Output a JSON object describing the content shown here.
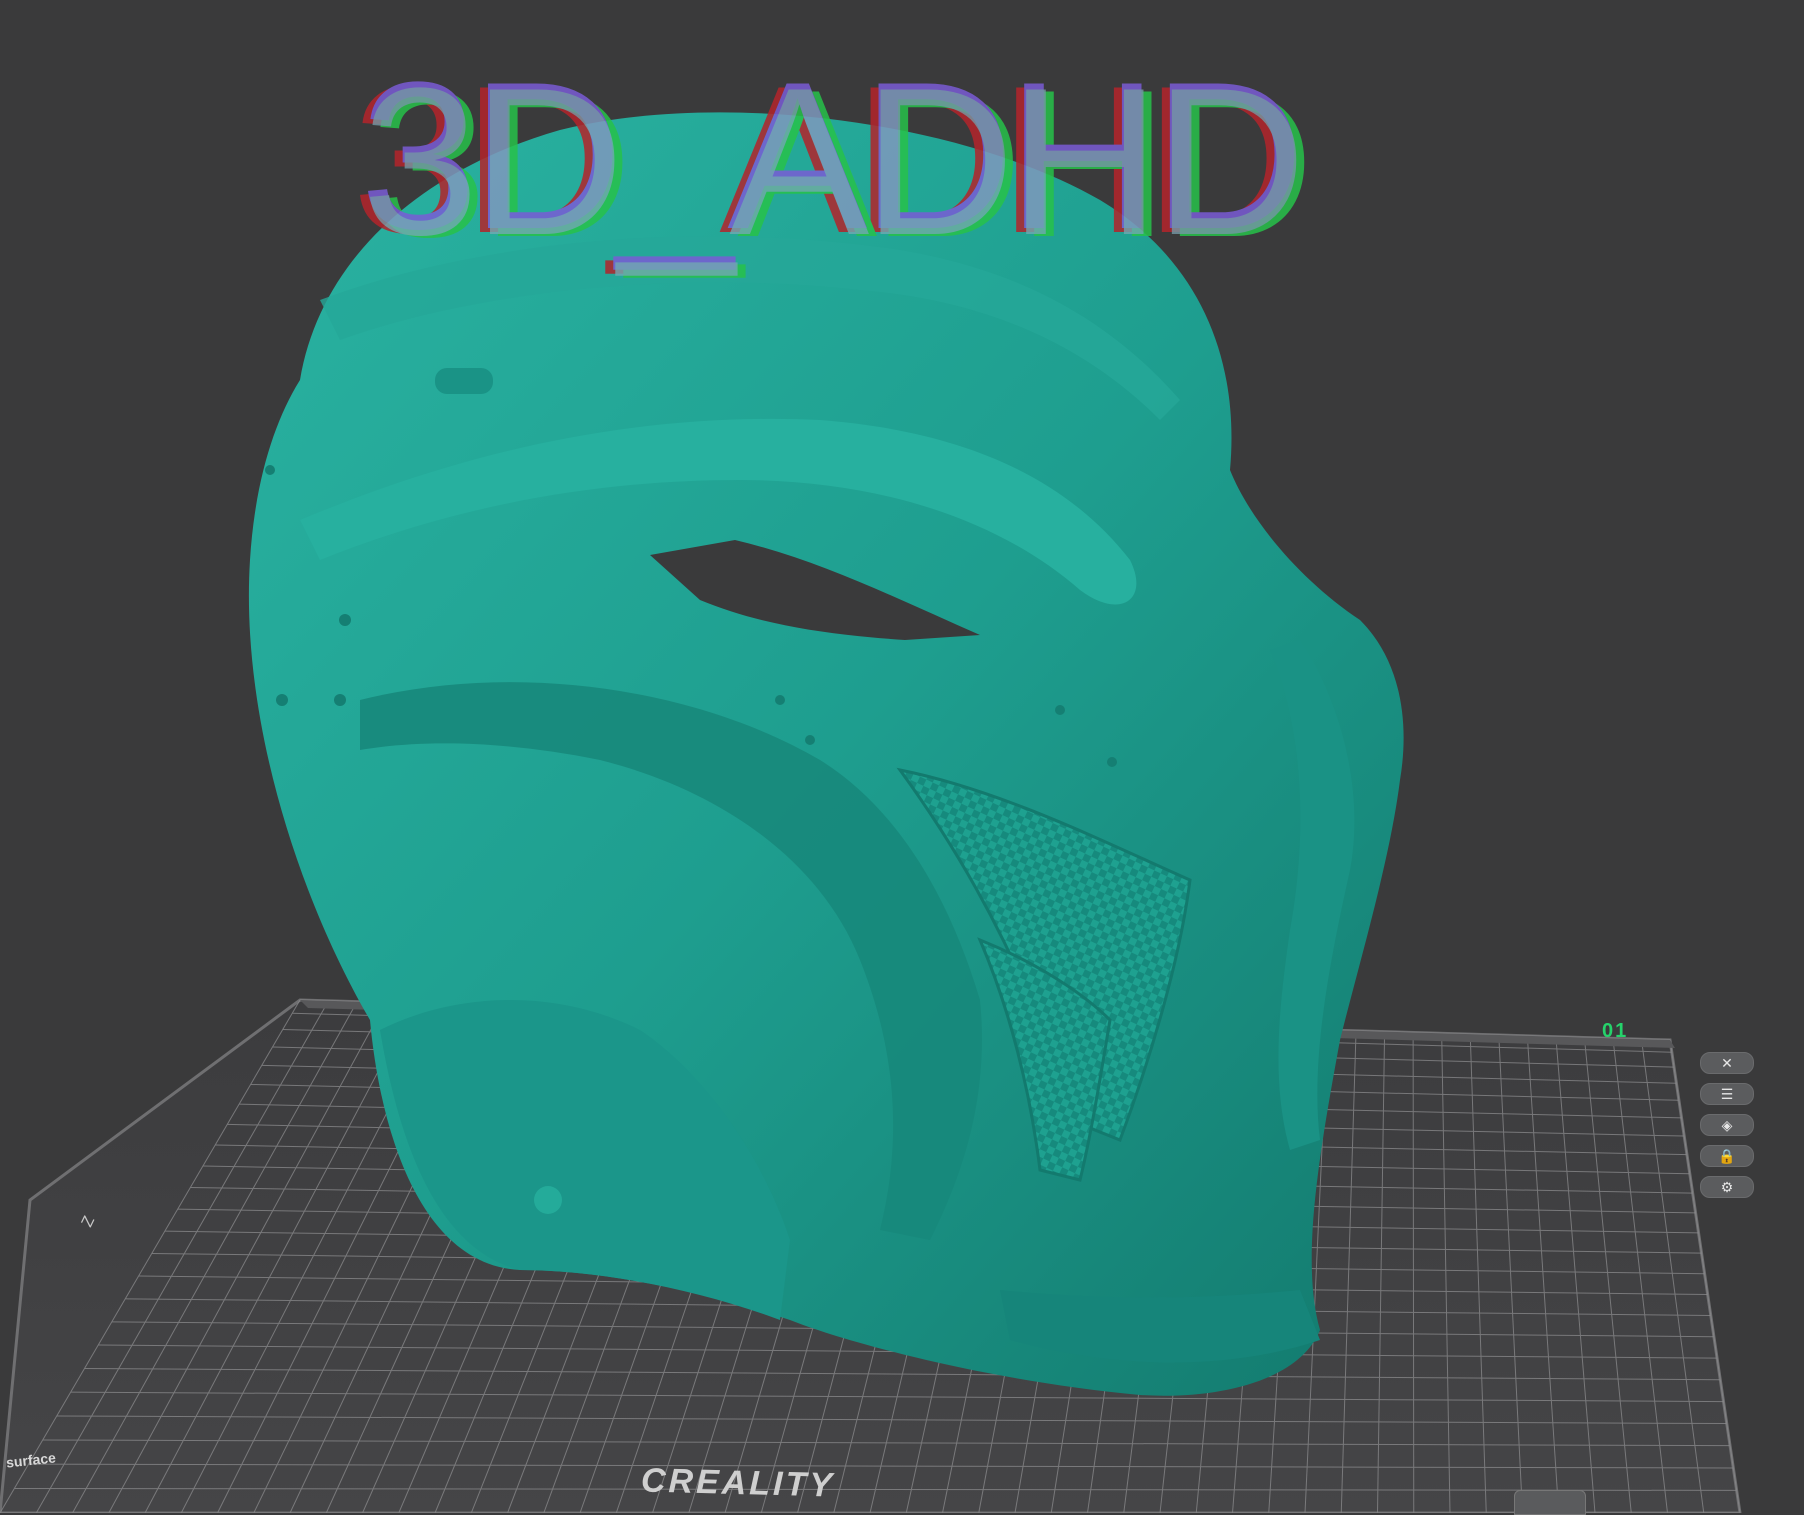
{
  "watermark": {
    "text": "3D_ADHD"
  },
  "plate": {
    "number_label": "01",
    "brand": "CREALITY",
    "axis_label": "Z",
    "corner_label": "surface"
  },
  "side_toolbar": {
    "items": [
      {
        "name": "close",
        "glyph": "✕"
      },
      {
        "name": "list",
        "glyph": "☰"
      },
      {
        "name": "layers",
        "glyph": "◈"
      },
      {
        "name": "lock",
        "glyph": "🔒"
      },
      {
        "name": "settings",
        "glyph": "⚙"
      }
    ]
  },
  "colors": {
    "background": "#3a3a3b",
    "model": "#1e9e8f",
    "grid_line": "#8b8b8d",
    "plate_number": "#25d36b"
  }
}
